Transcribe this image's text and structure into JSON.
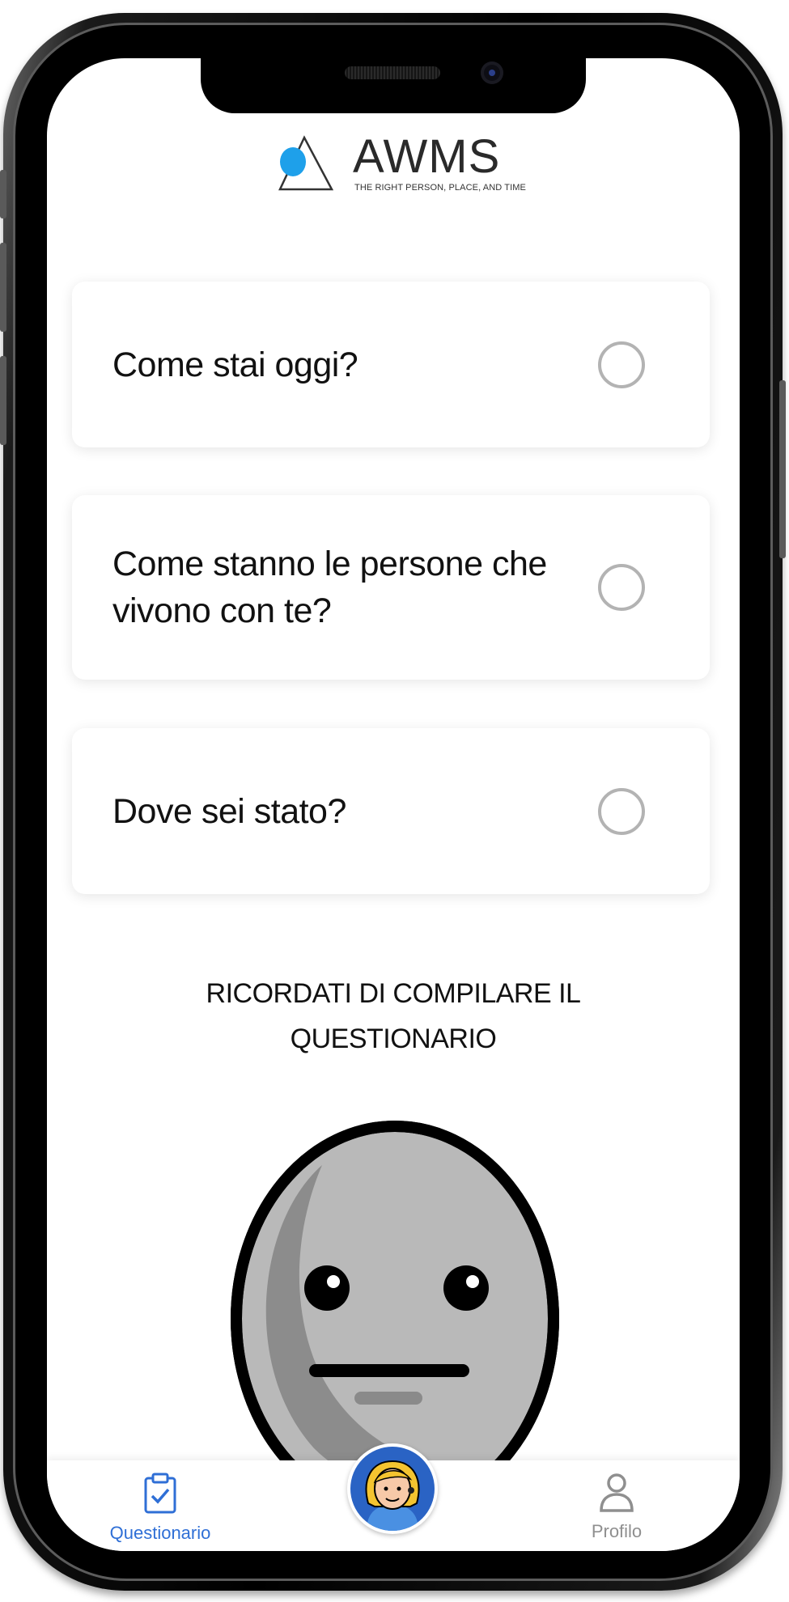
{
  "app": {
    "logo_text": "AWMS",
    "logo_tagline": "THE RIGHT PERSON, PLACE, AND TIME",
    "accent_color": "#2f6fd6",
    "logo_dot_color": "#1ea0ea"
  },
  "questions": [
    {
      "label": "Come stai oggi?",
      "checked": false
    },
    {
      "label": "Come stanno le persone che vivono con te?",
      "checked": false
    },
    {
      "label": "Dove sei stato?",
      "checked": false
    }
  ],
  "reminder": {
    "line1": "RICORDATI DI COMPILARE IL",
    "line2": "QUESTIONARIO"
  },
  "mood_icon": "neutral-face-icon",
  "bottom_nav": {
    "left": {
      "label": "Questionario",
      "icon": "clipboard-check-icon",
      "active": true
    },
    "center": {
      "icon": "assistant-avatar-icon"
    },
    "right": {
      "label": "Profilo",
      "icon": "user-icon",
      "active": false
    }
  }
}
